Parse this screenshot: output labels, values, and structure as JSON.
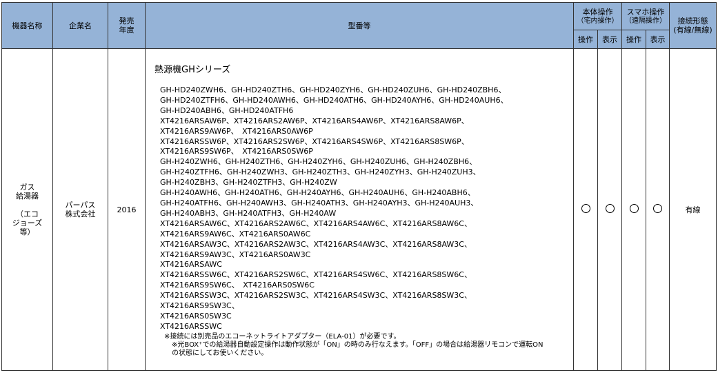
{
  "headers": {
    "device_name": "機器名称",
    "company": "企業名",
    "release_year_line1": "発売",
    "release_year_line2": "年度",
    "model": "型番等",
    "body_operation": "本体操作",
    "body_operation_sub": "（宅内操作）",
    "smartphone_operation": "スマホ操作",
    "smartphone_operation_sub": "（遠隔操作）",
    "connection_type": "接続形態",
    "connection_type_sub": "(有線/無線)",
    "operate": "操作",
    "display": "表示"
  },
  "row": {
    "device_name_lines": [
      "ガス",
      "給湯器",
      "",
      "（エコ",
      "ジョーズ",
      "等）"
    ],
    "company_lines": [
      "パーパス",
      "株式会社"
    ],
    "year": "2016",
    "series_title": "熱源機GHシリーズ",
    "model_lines": [
      "GH-HD240ZWH6、GH-HD240ZTH6、GH-HD240ZYH6、GH-HD240ZUH6、GH-HD240ZBH6、",
      "GH-HD240ZTFH6、GH-HD240AWH6、GH-HD240ATH6、GH-HD240AYH6、GH-HD240AUH6、",
      "GH-HD240ABH6、GH-HD240ATFH6",
      "XT4216ARSAW6P、XT4216ARS2AW6P、XT4216ARS4AW6P、XT4216ARS8AW6P、",
      "XT4216ARS9AW6P、　XT4216ARS0AW6P",
      "XT4216ARSSW6P、XT4216ARS2SW6P、XT4216ARS4SW6P、XT4216ARS8SW6P、",
      "XT4216ARS9SW6P、　XT4216ARS0SW6P",
      "GH-H240ZWH6、GH-H240ZTH6、GH-H240ZYH6、GH-H240ZUH6、GH-H240ZBH6、",
      "GH-H240ZTFH6、GH-H240ZWH3、GH-H240ZTH3、GH-H240ZYH3、GH-H240ZUH3、",
      "GH-H240ZBH3、GH-H240ZTFH3、GH-H240ZW",
      "GH-H240AWH6、GH-H240ATH6、GH-H240AYH6、GH-H240AUH6、GH-H240ABH6、",
      "GH-H240ATFH6、GH-H240AWH3、GH-H240ATH3、GH-H240AYH3、GH-H240AUH3、",
      "GH-H240ABH3、GH-H240ATFH3、GH-H240AW",
      "XT4216ARSAW6C、XT4216ARS2AW6C、XT4216ARS4AW6C、XT4216ARS8AW6C、",
      "XT4216ARS9AW6C、XT4216ARS0AW6C",
      "XT4216ARSAW3C、XT4216ARS2AW3C、XT4216ARS4AW3C、XT4216ARS8AW3C、",
      "XT4216ARS9AW3C、XT4216ARS0AW3C",
      "XT4216ARSAWC",
      "XT4216ARSSW6C、XT4216ARS2SW6C、XT4216ARS4SW6C、XT4216ARS8SW6C、",
      "XT4216ARS9SW6C、　XT4216ARS0SW6C",
      "XT4216ARSSW3C、XT4216ARS2SW3C、XT4216ARS4SW3C、XT4216ARS8SW3C、",
      "XT4216ARS9SW3C、",
      "XT4216ARS0SW3C",
      "XT4216ARSSWC"
    ],
    "note_1": "※接続には別売品のエコーネットライトアダプター（ELA-01）が必要です。",
    "note_2_line1": "※光BOX⁺での給湯器自動設定操作は動作状態が「ON」の時のみ行なえます。「OFF」の場合は給湯器リモコンで運転ON",
    "note_2_line2": "の状態にしてお使いください。",
    "connection": "有線"
  }
}
